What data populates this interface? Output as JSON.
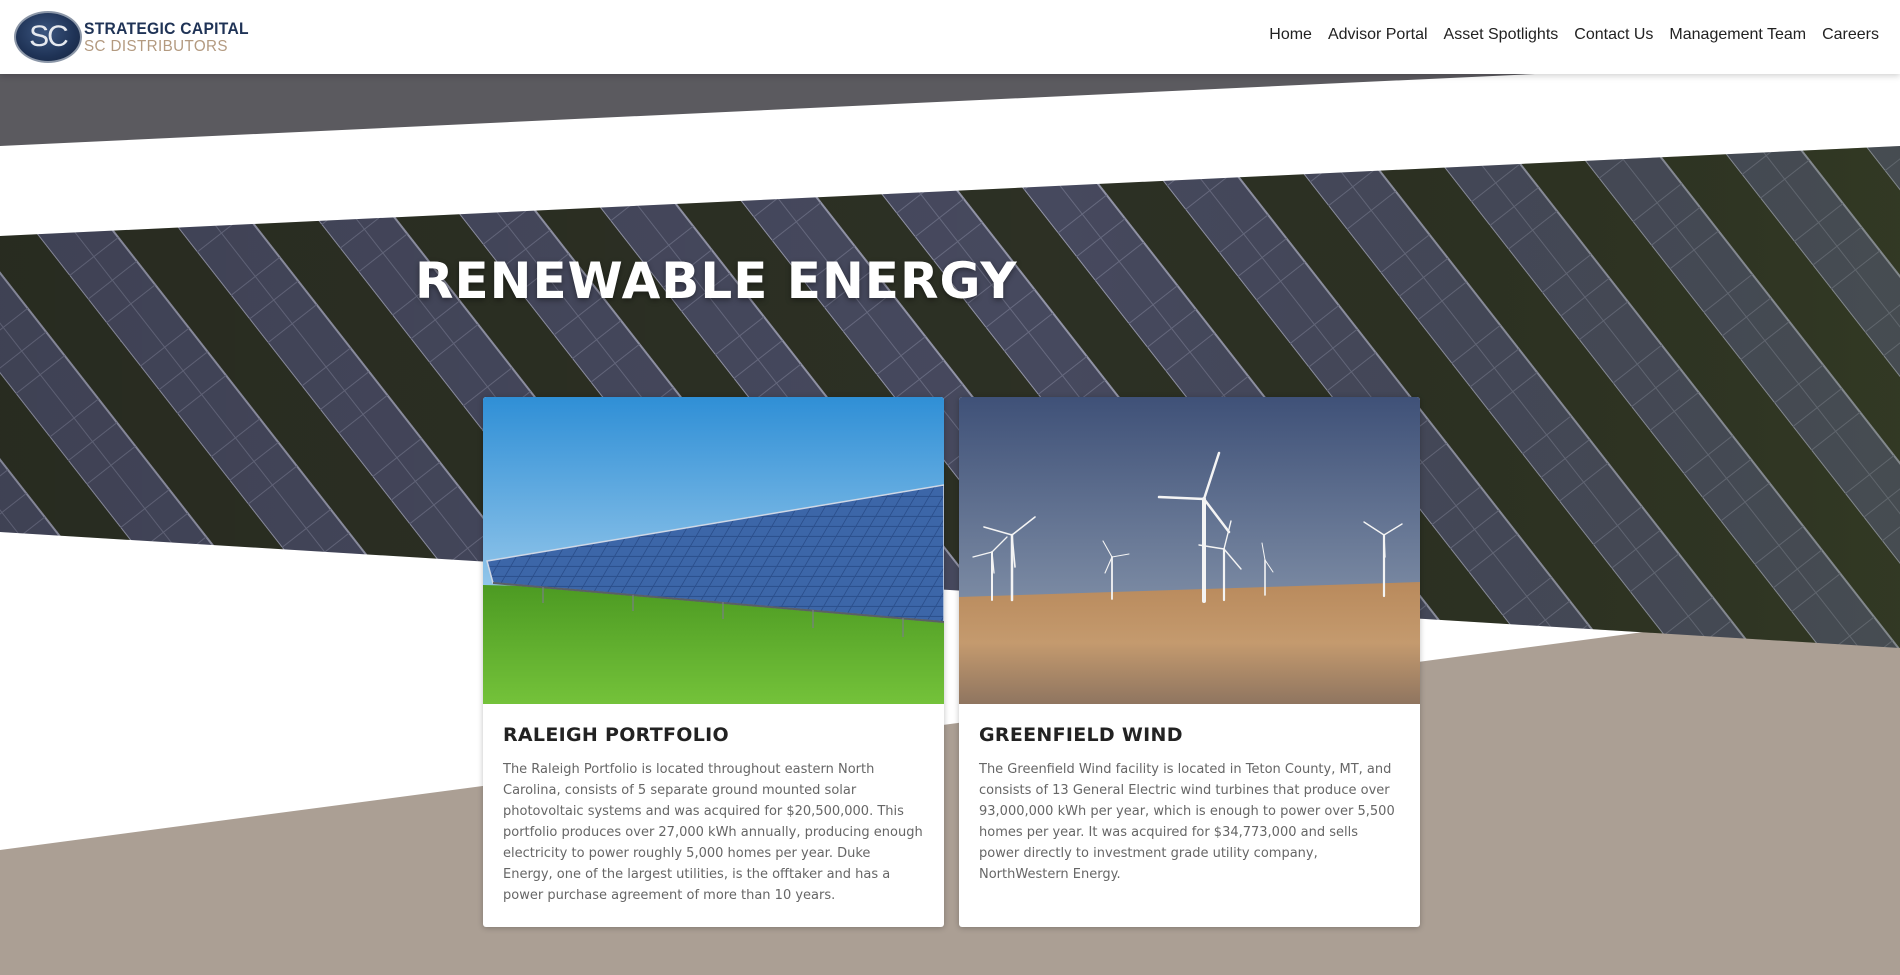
{
  "brand": {
    "monogram": "SC",
    "name_line1": "STRATEGIC CAPITAL",
    "name_line2": "SC DISTRIBUTORS"
  },
  "nav": {
    "items": [
      {
        "label": "Home"
      },
      {
        "label": "Advisor Portal"
      },
      {
        "label": "Asset Spotlights"
      },
      {
        "label": "Contact Us"
      },
      {
        "label": "Management Team"
      },
      {
        "label": "Careers"
      }
    ]
  },
  "hero": {
    "title": "RENEWABLE ENERGY"
  },
  "cards": [
    {
      "title": "RALEIGH PORTFOLIO",
      "description": "The Raleigh Portfolio is located throughout eastern North Carolina, consists of 5 separate ground mounted solar photovoltaic systems and was acquired for $20,500,000. This portfolio produces over 27,000 kWh annually, producing enough electricity to power roughly 5,000 homes per year. Duke Energy, one of the largest utilities, is the offtaker and has a power purchase agreement of more than 10 years."
    },
    {
      "title": "GREENFIELD WIND",
      "description": "The Greenfield Wind facility is located in Teton County, MT, and consists of 13 General Electric wind turbines that produce over 93,000,000 kWh per year, which is enough to power over 5,500 homes per year. It was acquired for $34,773,000 and sells power directly to investment grade utility company, NorthWestern Energy."
    }
  ],
  "colors": {
    "dark_band": "#5b5a5f",
    "taupe_band": "#ab9f94",
    "brand_navy": "#1f3356",
    "brand_tan": "#b39a80"
  }
}
